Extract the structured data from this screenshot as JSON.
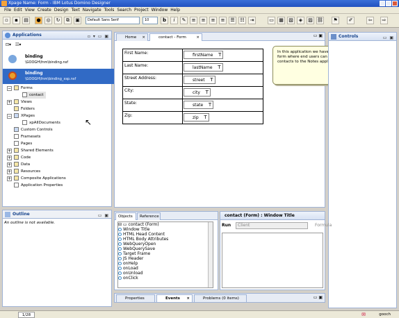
{
  "window": {
    "title": "Xpage Name: Form - IBM Lotus Domino Designer"
  },
  "menu": [
    "File",
    "Edit",
    "View",
    "Create",
    "Design",
    "Text",
    "Navigate",
    "Tools",
    "Search",
    "Project",
    "Window",
    "Help"
  ],
  "toolbar": {
    "font": "Default Sans Serif",
    "size": "10"
  },
  "applications": {
    "title": "Applications",
    "databases": [
      {
        "name": "binding",
        "path": "\\GOOGH\\fnm\\binding.nsf"
      },
      {
        "name": "binding",
        "path": "\\GOOGH\\fnm\\binding_xsp.nsf"
      }
    ],
    "tree": [
      "Forms",
      "contact",
      "Views",
      "Folders",
      "XPages",
      "xpAllDocuments",
      "Custom Controls",
      "Framesets",
      "Pages",
      "Shared Elements",
      "Code",
      "Data",
      "Resources",
      "Composite Applications",
      "Application Properties"
    ]
  },
  "outline": {
    "title": "Outline",
    "message": "An outline is not available."
  },
  "editor": {
    "tabs": [
      "Home",
      "contact - Form"
    ],
    "rows": [
      {
        "label": "First Name:",
        "field": "firstName"
      },
      {
        "label": "Last Name:",
        "field": "lastName"
      },
      {
        "label": "Street Address:",
        "field": "street"
      },
      {
        "label": "City:",
        "field": "city"
      },
      {
        "label": "State:",
        "field": "state"
      },
      {
        "label": "Zip:",
        "field": "zip"
      }
    ],
    "callout": "In this application we have a basic form where end users can add contacts to the Notes application.",
    "text_marker": "T"
  },
  "controls": {
    "title": "Controls"
  },
  "objects": {
    "tabs": [
      "Objects",
      "Reference"
    ],
    "root": "contact (Form)",
    "events": [
      "Window Title",
      "HTML Head Content",
      "HTML Body Attributes",
      "WebQueryOpen",
      "WebQuerySave",
      "Target Frame",
      "JS Header",
      "onHelp",
      "onLoad",
      "onUnload",
      "onClick"
    ]
  },
  "script": {
    "title": "contact (Form) : Window Title",
    "run_label": "Run",
    "run_value": "Client",
    "lang": "Formula"
  },
  "bottom_tabs": [
    "Properties",
    "Events",
    "Problems (0 items)"
  ],
  "status": {
    "page": "1/28",
    "user": "gooch"
  }
}
